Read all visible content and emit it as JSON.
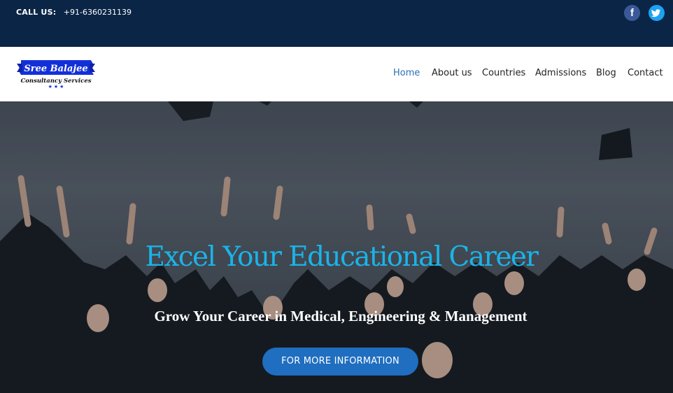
{
  "topbar": {
    "call_label": "CALL US:",
    "phone": "+91-6360231139",
    "social": [
      {
        "icon": "facebook-icon",
        "glyph": "f"
      },
      {
        "icon": "twitter-icon",
        "glyph": "t"
      }
    ]
  },
  "logo": {
    "line1": "Sree Balajee",
    "line2": "Consultancy Services"
  },
  "nav": {
    "items": [
      {
        "label": "Home",
        "active": true
      },
      {
        "label": "About us",
        "active": false
      },
      {
        "label": "Countries",
        "active": false
      },
      {
        "label": "Admissions",
        "active": false
      },
      {
        "label": "Blog",
        "active": false
      },
      {
        "label": "Contact",
        "active": false
      }
    ]
  },
  "hero": {
    "headline": "Excel Your Educational Career",
    "subheadline": "Grow Your Career in Medical, Engineering & Management",
    "cta_label": "FOR MORE INFORMATION"
  },
  "colors": {
    "topbar_bg": "#0b2546",
    "nav_active": "#2f6fb3",
    "headline": "#1ab4e8",
    "cta_bg": "#1f6ec0"
  }
}
